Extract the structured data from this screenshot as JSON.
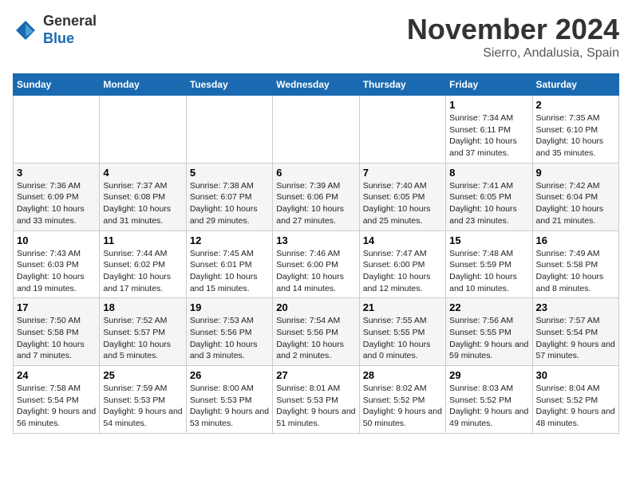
{
  "header": {
    "logo_general": "General",
    "logo_blue": "Blue",
    "month_title": "November 2024",
    "location": "Sierro, Andalusia, Spain"
  },
  "weekdays": [
    "Sunday",
    "Monday",
    "Tuesday",
    "Wednesday",
    "Thursday",
    "Friday",
    "Saturday"
  ],
  "weeks": [
    [
      {
        "day": "",
        "info": ""
      },
      {
        "day": "",
        "info": ""
      },
      {
        "day": "",
        "info": ""
      },
      {
        "day": "",
        "info": ""
      },
      {
        "day": "",
        "info": ""
      },
      {
        "day": "1",
        "info": "Sunrise: 7:34 AM\nSunset: 6:11 PM\nDaylight: 10 hours and 37 minutes."
      },
      {
        "day": "2",
        "info": "Sunrise: 7:35 AM\nSunset: 6:10 PM\nDaylight: 10 hours and 35 minutes."
      }
    ],
    [
      {
        "day": "3",
        "info": "Sunrise: 7:36 AM\nSunset: 6:09 PM\nDaylight: 10 hours and 33 minutes."
      },
      {
        "day": "4",
        "info": "Sunrise: 7:37 AM\nSunset: 6:08 PM\nDaylight: 10 hours and 31 minutes."
      },
      {
        "day": "5",
        "info": "Sunrise: 7:38 AM\nSunset: 6:07 PM\nDaylight: 10 hours and 29 minutes."
      },
      {
        "day": "6",
        "info": "Sunrise: 7:39 AM\nSunset: 6:06 PM\nDaylight: 10 hours and 27 minutes."
      },
      {
        "day": "7",
        "info": "Sunrise: 7:40 AM\nSunset: 6:05 PM\nDaylight: 10 hours and 25 minutes."
      },
      {
        "day": "8",
        "info": "Sunrise: 7:41 AM\nSunset: 6:05 PM\nDaylight: 10 hours and 23 minutes."
      },
      {
        "day": "9",
        "info": "Sunrise: 7:42 AM\nSunset: 6:04 PM\nDaylight: 10 hours and 21 minutes."
      }
    ],
    [
      {
        "day": "10",
        "info": "Sunrise: 7:43 AM\nSunset: 6:03 PM\nDaylight: 10 hours and 19 minutes."
      },
      {
        "day": "11",
        "info": "Sunrise: 7:44 AM\nSunset: 6:02 PM\nDaylight: 10 hours and 17 minutes."
      },
      {
        "day": "12",
        "info": "Sunrise: 7:45 AM\nSunset: 6:01 PM\nDaylight: 10 hours and 15 minutes."
      },
      {
        "day": "13",
        "info": "Sunrise: 7:46 AM\nSunset: 6:00 PM\nDaylight: 10 hours and 14 minutes."
      },
      {
        "day": "14",
        "info": "Sunrise: 7:47 AM\nSunset: 6:00 PM\nDaylight: 10 hours and 12 minutes."
      },
      {
        "day": "15",
        "info": "Sunrise: 7:48 AM\nSunset: 5:59 PM\nDaylight: 10 hours and 10 minutes."
      },
      {
        "day": "16",
        "info": "Sunrise: 7:49 AM\nSunset: 5:58 PM\nDaylight: 10 hours and 8 minutes."
      }
    ],
    [
      {
        "day": "17",
        "info": "Sunrise: 7:50 AM\nSunset: 5:58 PM\nDaylight: 10 hours and 7 minutes."
      },
      {
        "day": "18",
        "info": "Sunrise: 7:52 AM\nSunset: 5:57 PM\nDaylight: 10 hours and 5 minutes."
      },
      {
        "day": "19",
        "info": "Sunrise: 7:53 AM\nSunset: 5:56 PM\nDaylight: 10 hours and 3 minutes."
      },
      {
        "day": "20",
        "info": "Sunrise: 7:54 AM\nSunset: 5:56 PM\nDaylight: 10 hours and 2 minutes."
      },
      {
        "day": "21",
        "info": "Sunrise: 7:55 AM\nSunset: 5:55 PM\nDaylight: 10 hours and 0 minutes."
      },
      {
        "day": "22",
        "info": "Sunrise: 7:56 AM\nSunset: 5:55 PM\nDaylight: 9 hours and 59 minutes."
      },
      {
        "day": "23",
        "info": "Sunrise: 7:57 AM\nSunset: 5:54 PM\nDaylight: 9 hours and 57 minutes."
      }
    ],
    [
      {
        "day": "24",
        "info": "Sunrise: 7:58 AM\nSunset: 5:54 PM\nDaylight: 9 hours and 56 minutes."
      },
      {
        "day": "25",
        "info": "Sunrise: 7:59 AM\nSunset: 5:53 PM\nDaylight: 9 hours and 54 minutes."
      },
      {
        "day": "26",
        "info": "Sunrise: 8:00 AM\nSunset: 5:53 PM\nDaylight: 9 hours and 53 minutes."
      },
      {
        "day": "27",
        "info": "Sunrise: 8:01 AM\nSunset: 5:53 PM\nDaylight: 9 hours and 51 minutes."
      },
      {
        "day": "28",
        "info": "Sunrise: 8:02 AM\nSunset: 5:52 PM\nDaylight: 9 hours and 50 minutes."
      },
      {
        "day": "29",
        "info": "Sunrise: 8:03 AM\nSunset: 5:52 PM\nDaylight: 9 hours and 49 minutes."
      },
      {
        "day": "30",
        "info": "Sunrise: 8:04 AM\nSunset: 5:52 PM\nDaylight: 9 hours and 48 minutes."
      }
    ]
  ]
}
